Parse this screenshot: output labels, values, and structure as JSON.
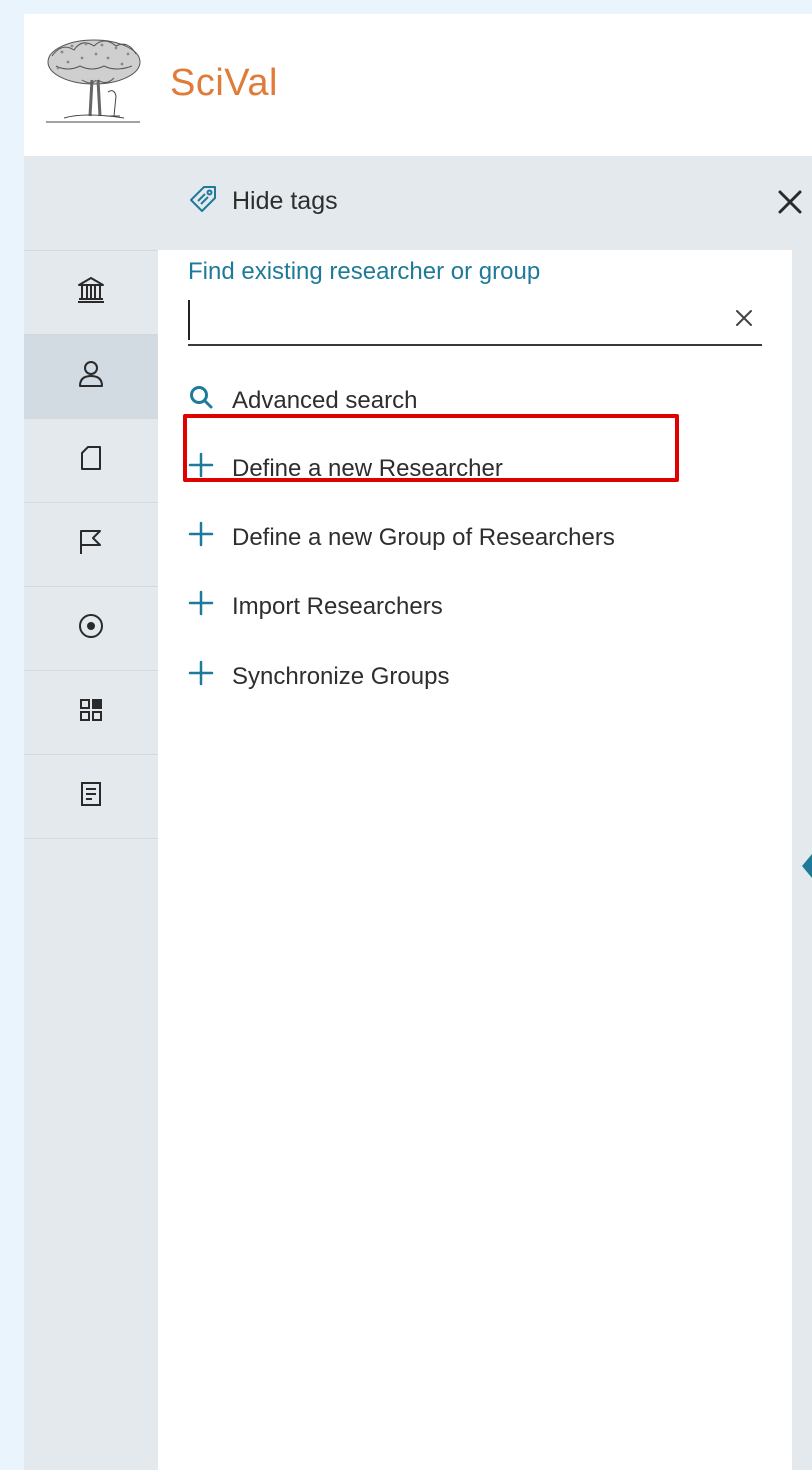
{
  "app": {
    "brand": "SciVal"
  },
  "tagbar": {
    "hide_tags_label": "Hide tags"
  },
  "sidebar": {
    "items": [
      {
        "name": "institution-icon"
      },
      {
        "name": "researcher-icon",
        "active": true
      },
      {
        "name": "publication-icon"
      },
      {
        "name": "country-flag-icon"
      },
      {
        "name": "topic-target-icon"
      },
      {
        "name": "dashboard-grid-icon"
      },
      {
        "name": "report-icon"
      }
    ]
  },
  "panel": {
    "find_label": "Find existing researcher or group",
    "search": {
      "value": "",
      "placeholder": ""
    },
    "advanced_search": "Advanced search",
    "actions": [
      {
        "label": "Define a new Researcher",
        "highlighted": true
      },
      {
        "label": "Define a new Group of Researchers"
      },
      {
        "label": "Import Researchers"
      },
      {
        "label": "Synchronize Groups"
      }
    ]
  },
  "colors": {
    "brand": "#e07b39",
    "accent": "#1f7a9a",
    "sidebar_bg": "#e4e9ee",
    "highlight_border": "#e00000"
  }
}
